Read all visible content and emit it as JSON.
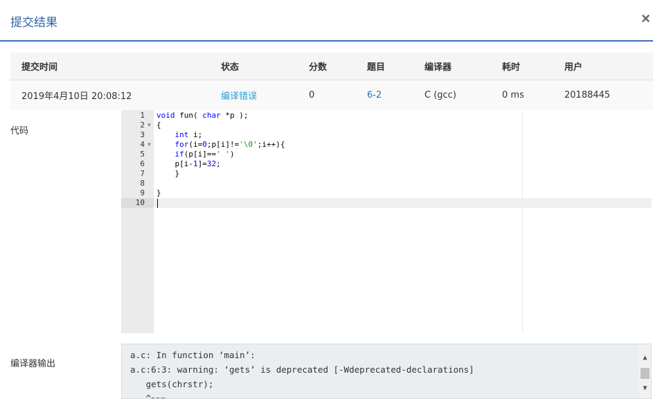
{
  "modal": {
    "title": "提交结果",
    "close": "×"
  },
  "table": {
    "headers": [
      "提交时间",
      "状态",
      "分数",
      "题目",
      "编译器",
      "耗时",
      "用户"
    ],
    "row": {
      "time": "2019年4月10日 20:08:12",
      "status": "编译错误",
      "score": "0",
      "problem": "6-2",
      "compiler": "C (gcc)",
      "elapsed": "0 ms",
      "user": "20188445"
    }
  },
  "code_label": "代码",
  "code_lines": [
    "void fun( char *p );",
    "{",
    "    int i;",
    "    for(i=0;p[i]!='\\0';i++){",
    "    if(p[i]==' ')",
    "    p[i-1]=32;",
    "    }",
    "",
    "}",
    ""
  ],
  "line_numbers": [
    "1",
    "2",
    "3",
    "4",
    "5",
    "6",
    "7",
    "8",
    "9",
    "10"
  ],
  "output_label": "编译器输出",
  "compiler_output": [
    "a.c: In function ‘main’:",
    "a.c:6:3: warning: ‘gets’ is deprecated [-Wdeprecated-declarations]",
    "   gets(chrstr);",
    "   ^~~~"
  ],
  "colors": {
    "accent": "#2f63ac",
    "status_error": "#27a0d8",
    "link": "#2a73b8"
  }
}
